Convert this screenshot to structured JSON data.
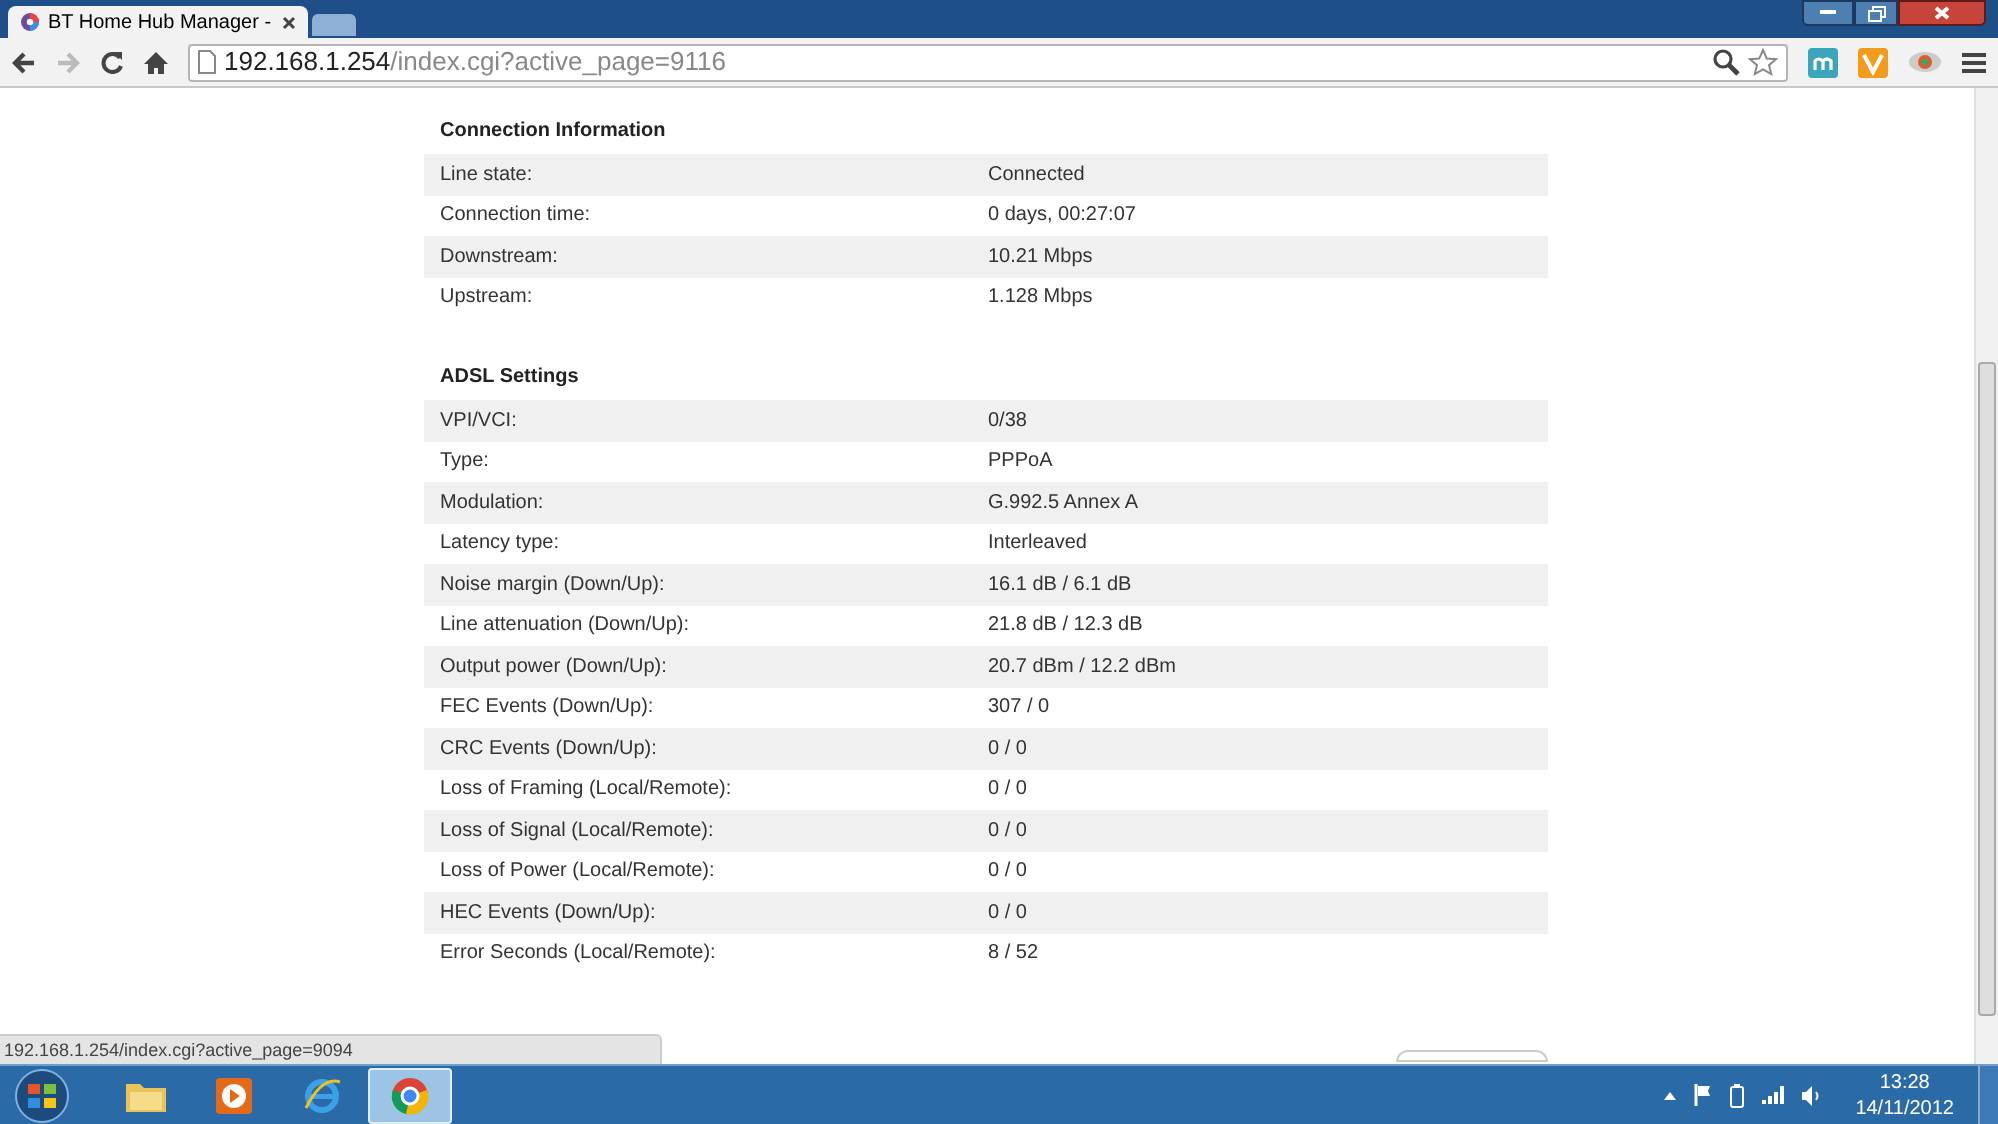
{
  "browser": {
    "tabs": [
      {
        "title": "BT Home Hub Manager -",
        "selected": true
      },
      {
        "selected": false
      }
    ],
    "address": {
      "host": "192.168.1.254",
      "path": "/index.cgi?active_page=9116"
    }
  },
  "sections": [
    {
      "title": "Connection Information",
      "rows": [
        {
          "label": "Line state:",
          "value": "Connected"
        },
        {
          "label": "Connection time:",
          "value": "0 days, 00:27:07"
        },
        {
          "label": "Downstream:",
          "value": "10.21 Mbps"
        },
        {
          "label": "Upstream:",
          "value": "1.128 Mbps"
        }
      ]
    },
    {
      "title": "ADSL Settings",
      "rows": [
        {
          "label": "VPI/VCI:",
          "value": "0/38"
        },
        {
          "label": "Type:",
          "value": "PPPoA"
        },
        {
          "label": "Modulation:",
          "value": "G.992.5 Annex A"
        },
        {
          "label": "Latency type:",
          "value": "Interleaved"
        },
        {
          "label": "Noise margin (Down/Up):",
          "value": "16.1 dB / 6.1 dB"
        },
        {
          "label": "Line attenuation (Down/Up):",
          "value": "21.8 dB / 12.3 dB"
        },
        {
          "label": "Output power (Down/Up):",
          "value": "20.7 dBm / 12.2 dBm"
        },
        {
          "label": "FEC Events (Down/Up):",
          "value": "307 / 0"
        },
        {
          "label": "CRC Events (Down/Up):",
          "value": "0 / 0"
        },
        {
          "label": "Loss of Framing (Local/Remote):",
          "value": "0 / 0"
        },
        {
          "label": "Loss of Signal (Local/Remote):",
          "value": "0 / 0"
        },
        {
          "label": "Loss of Power (Local/Remote):",
          "value": "0 / 0"
        },
        {
          "label": "HEC Events (Down/Up):",
          "value": "0 / 0"
        },
        {
          "label": "Error Seconds (Local/Remote):",
          "value": "8 / 52"
        }
      ]
    }
  ],
  "status_bubble": "192.168.1.254/index.cgi?active_page=9094",
  "taskbar": {
    "apps": [
      {
        "kind": "explorer",
        "selected": false
      },
      {
        "kind": "media",
        "selected": false
      },
      {
        "kind": "ie",
        "selected": false
      },
      {
        "kind": "chrome",
        "selected": true
      }
    ],
    "time": "13:28",
    "date": "14/11/2012"
  }
}
